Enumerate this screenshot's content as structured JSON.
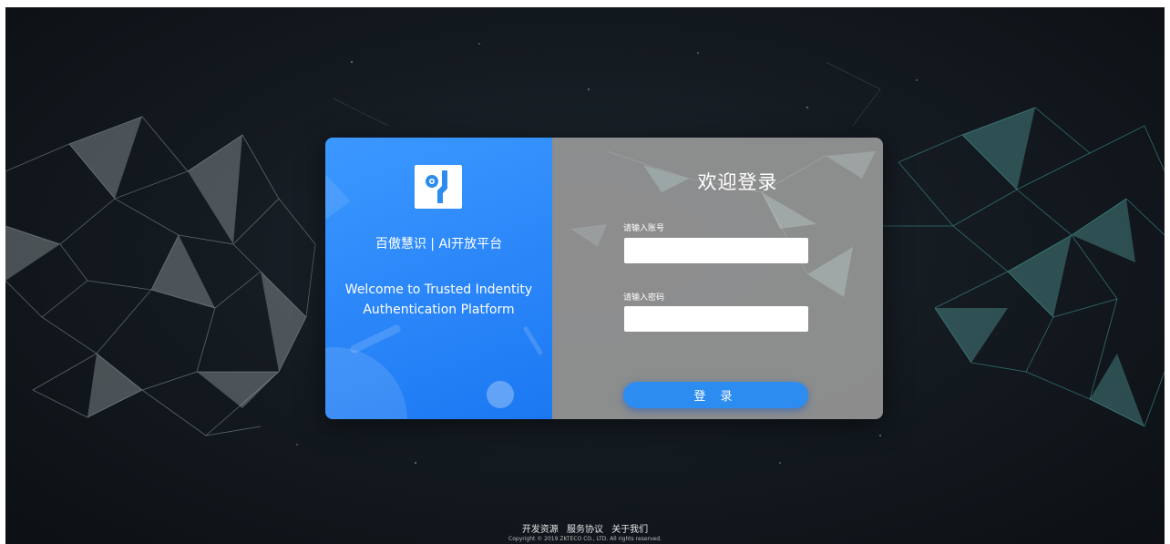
{
  "brand": {
    "name": "百傲慧识 | AI开放平台",
    "welcome_line1": "Welcome to Trusted Indentity",
    "welcome_line2": "Authentication Platform"
  },
  "login_form": {
    "title": "欢迎登录",
    "username_label": "请输入账号",
    "username_value": "",
    "password_label": "请输入密码",
    "password_value": "",
    "submit_label": "登 录"
  },
  "footer": {
    "links": [
      "开发资源",
      "服务协议",
      "关于我们"
    ],
    "copyright": "Copyright © 2019 ZKTECO CO., LTD. All rights reserved."
  },
  "colors": {
    "accent": "#2d8cf0",
    "panel_blue": "#2a86f8",
    "panel_gray": "#969696",
    "background": "#141b21"
  },
  "icons": [
    "app-logo-icon"
  ]
}
